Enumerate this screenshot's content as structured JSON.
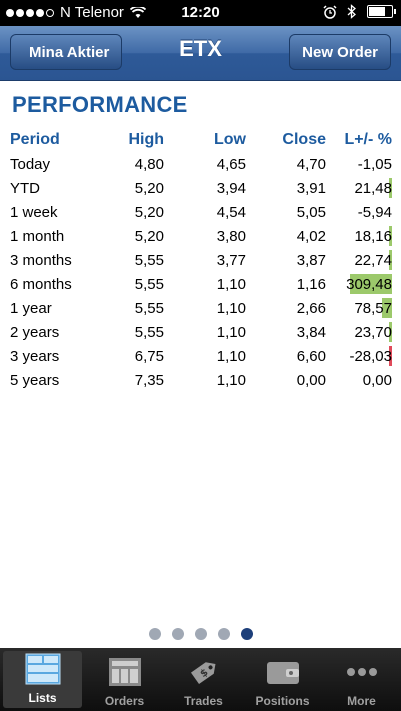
{
  "status_bar": {
    "carrier": "N Telenor",
    "time": "12:20",
    "signal_dots": 5
  },
  "nav": {
    "back_label": "Mina Aktier",
    "title": "ETX",
    "new_order_label": "New Order"
  },
  "section_title": "PERFORMANCE",
  "table": {
    "headers": {
      "period": "Period",
      "high": "High",
      "low": "Low",
      "close": "Close",
      "lp": "L+/- %"
    },
    "rows": [
      {
        "period": "Today",
        "high": "4,80",
        "low": "4,65",
        "close": "4,70",
        "lp": "-1,05",
        "bar_pct": 0,
        "bar_color": ""
      },
      {
        "period": "YTD",
        "high": "5,20",
        "low": "3,94",
        "close": "3,91",
        "lp": "21,48",
        "bar_pct": 4,
        "bar_color": "#9cc96b"
      },
      {
        "period": "1 week",
        "high": "5,20",
        "low": "4,54",
        "close": "5,05",
        "lp": "-5,94",
        "bar_pct": 0,
        "bar_color": ""
      },
      {
        "period": "1 month",
        "high": "5,20",
        "low": "3,80",
        "close": "4,02",
        "lp": "18,16",
        "bar_pct": 3,
        "bar_color": "#9cc96b"
      },
      {
        "period": "3 months",
        "high": "5,55",
        "low": "3,77",
        "close": "3,87",
        "lp": "22,74",
        "bar_pct": 5,
        "bar_color": "#9cc96b"
      },
      {
        "period": "6 months",
        "high": "5,55",
        "low": "1,10",
        "close": "1,16",
        "lp": "309,48",
        "bar_pct": 100,
        "bar_color": "#9cc96b"
      },
      {
        "period": "1 year",
        "high": "5,55",
        "low": "1,10",
        "close": "2,66",
        "lp": "78,57",
        "bar_pct": 25,
        "bar_color": "#9cc96b"
      },
      {
        "period": "2 years",
        "high": "5,55",
        "low": "1,10",
        "close": "3,84",
        "lp": "23,70",
        "bar_pct": 5,
        "bar_color": "#9cc96b"
      },
      {
        "period": "3 years",
        "high": "6,75",
        "low": "1,10",
        "close": "6,60",
        "lp": "-28,03",
        "bar_pct": 4,
        "bar_color": "#e04a5a"
      },
      {
        "period": "5 years",
        "high": "7,35",
        "low": "1,10",
        "close": "0,00",
        "lp": "0,00",
        "bar_pct": 0,
        "bar_color": ""
      }
    ]
  },
  "page_indicator": {
    "count": 5,
    "active_index": 4
  },
  "tabs": [
    {
      "label": "Lists",
      "icon": "lists-icon",
      "active": true
    },
    {
      "label": "Orders",
      "icon": "orders-icon",
      "active": false
    },
    {
      "label": "Trades",
      "icon": "trades-icon",
      "active": false
    },
    {
      "label": "Positions",
      "icon": "positions-icon",
      "active": false
    },
    {
      "label": "More",
      "icon": "more-icon",
      "active": false
    }
  ]
}
